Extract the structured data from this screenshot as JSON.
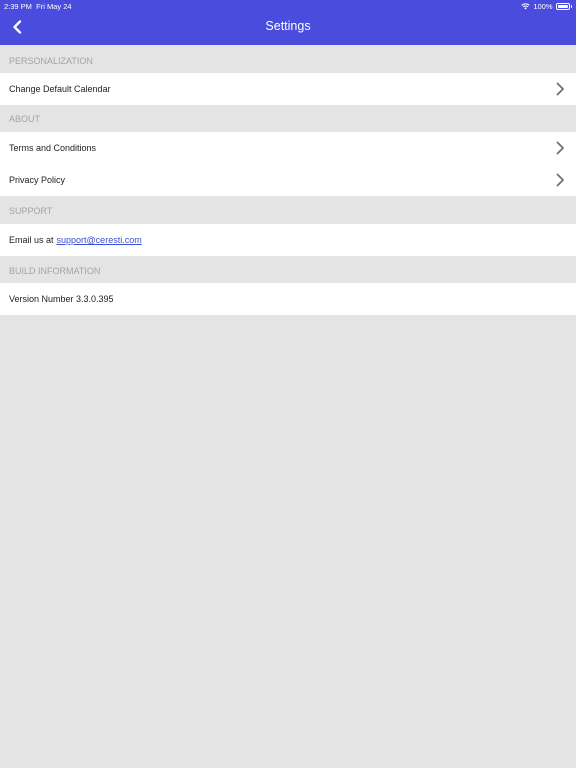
{
  "status_bar": {
    "time": "2:39 PM",
    "date": "Fri May 24",
    "battery": "100%"
  },
  "nav": {
    "title": "Settings",
    "back_icon": "chevron-left-icon"
  },
  "colors": {
    "header_bg": "#4a4cde",
    "page_bg": "#e4e4e4",
    "section_text": "#a3a3a3",
    "link": "#3b4fd9"
  },
  "sections": {
    "personalization": {
      "header": "PERSONALIZATION",
      "items": [
        {
          "label": "Change Default Calendar"
        }
      ]
    },
    "about": {
      "header": "ABOUT",
      "items": [
        {
          "label": "Terms and Conditions"
        },
        {
          "label": "Privacy Policy"
        }
      ]
    },
    "support": {
      "header": "SUPPORT",
      "email_prefix": "Email us at",
      "email": "support@ceresti.com"
    },
    "build": {
      "header": "BUILD INFORMATION",
      "version": "Version Number 3.3.0.395"
    }
  }
}
